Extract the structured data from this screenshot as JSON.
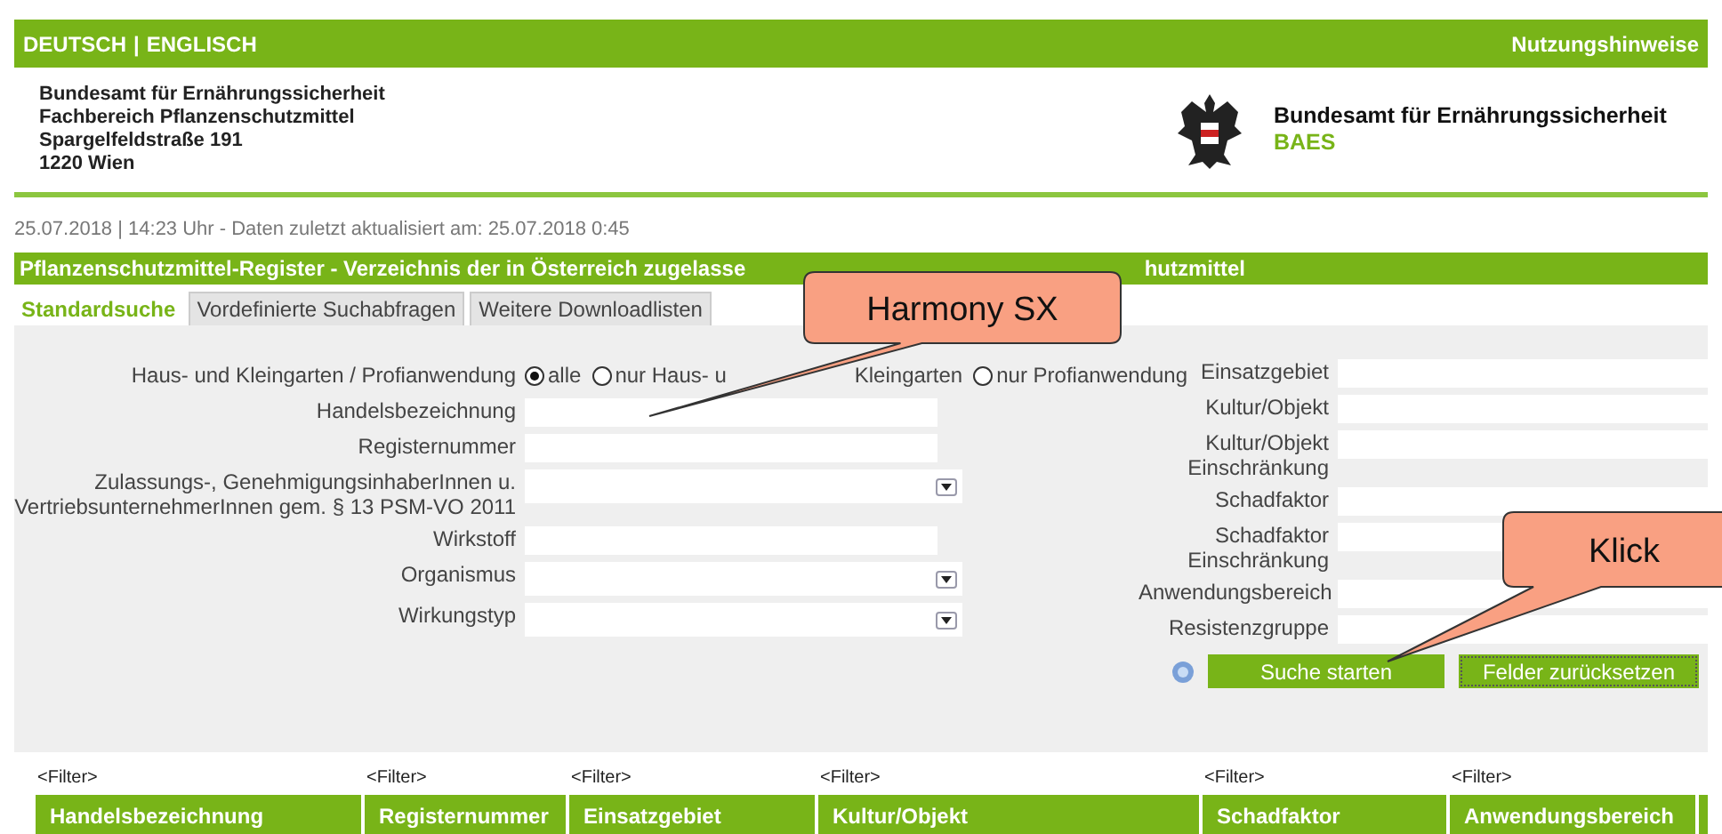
{
  "top_bar": {
    "languages": [
      "DEUTSCH",
      "ENGLISCH"
    ],
    "separator": "|",
    "link": "Nutzungshinweise"
  },
  "header": {
    "address": [
      "Bundesamt für Ernährungssicherheit",
      "Fachbereich Pflanzenschutzmittel",
      "Spargelfeldstraße 191",
      "1220 Wien"
    ],
    "agency": "Bundesamt für Ernährungssicherheit",
    "abbreviation": "BAES"
  },
  "timestamp": "25.07.2018 | 14:23 Uhr - Daten zuletzt aktualisiert am: 25.07.2018 0:45",
  "title_bar": {
    "text_start": "Pflanzenschutzmittel-Register - Verzeichnis der in Österreich zugelasse",
    "text_end": "hutzmittel"
  },
  "tabs": [
    {
      "label": "Standardsuche",
      "selected": true
    },
    {
      "label": "Vordefinierte Suchabfragen",
      "selected": false
    },
    {
      "label": "Weitere Downloadlisten",
      "selected": false
    }
  ],
  "form": {
    "radio_group": {
      "label": "Haus- und Kleingarten / Profianwendung",
      "options": [
        {
          "label": "alle",
          "selected": true
        },
        {
          "label": "nur Haus- u",
          "label_continued": "Kleingarten",
          "selected": false
        },
        {
          "label": "nur Profianwendung",
          "selected": false
        }
      ]
    },
    "left_fields": [
      {
        "label": "Handelsbezeichnung",
        "kind": "text"
      },
      {
        "label": "Registernummer",
        "kind": "text"
      },
      {
        "label": "Zulassungs-, GenehmigungsinhaberInnen u. VertriebsunternehmerInnen gem. § 13 PSM-VO 2011",
        "kind": "select"
      },
      {
        "label": "Wirkstoff",
        "kind": "text"
      },
      {
        "label": "Organismus",
        "kind": "select"
      },
      {
        "label": "Wirkungstyp",
        "kind": "select"
      }
    ],
    "right_fields": [
      {
        "label": "Einsatzgebiet"
      },
      {
        "label": "Kultur/Objekt"
      },
      {
        "label": "Kultur/Objekt Einschränkung"
      },
      {
        "label": "Schadfaktor"
      },
      {
        "label": "Schadfaktor Einschränkung"
      },
      {
        "label": "Anwendungsbereich"
      },
      {
        "label": "Resistenzgruppe"
      }
    ],
    "buttons": [
      "Suche starten",
      "Felder zurücksetzen"
    ]
  },
  "table": {
    "columns": [
      {
        "filter": "<Filter>",
        "title": "Handelsbezeichnung"
      },
      {
        "filter": "<Filter>",
        "title": "Registernummer"
      },
      {
        "filter": "<Filter>",
        "title": "Einsatzgebiet"
      },
      {
        "filter": "<Filter>",
        "title": "Kultur/Objekt"
      },
      {
        "filter": "<Filter>",
        "title": "Schadfaktor"
      },
      {
        "filter": "<Filter>",
        "title": "Anwendungsbereich"
      }
    ]
  },
  "callouts": [
    {
      "text": "Harmony SX"
    },
    {
      "text": "Klick"
    }
  ]
}
